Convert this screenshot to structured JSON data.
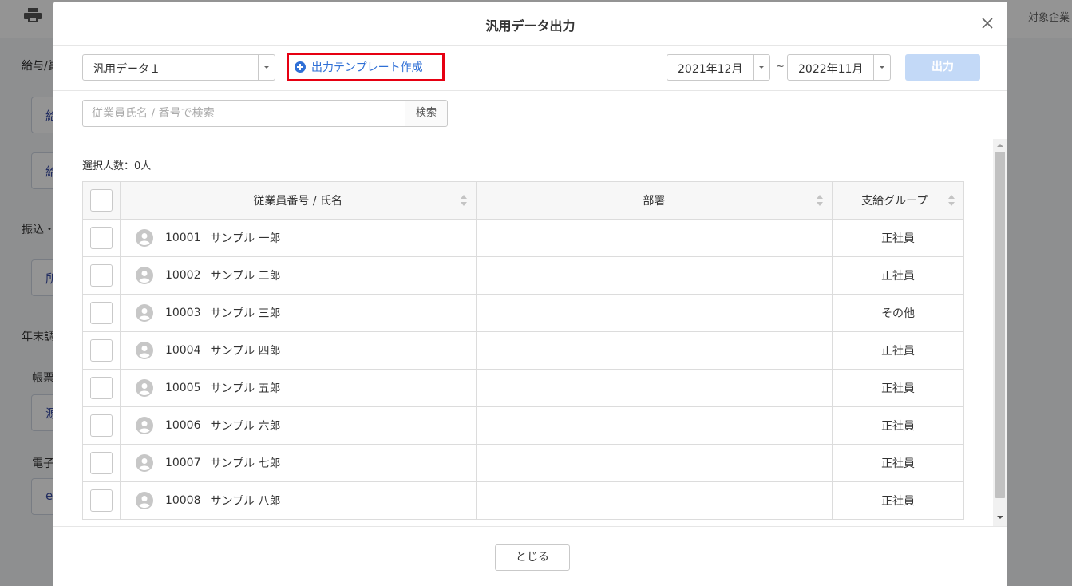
{
  "background": {
    "target_company": "対象企業",
    "sections": [
      "給与/賞",
      "振込・",
      "年末調",
      "帳票",
      "電子"
    ],
    "buttons": [
      "給",
      "給",
      "所",
      "源",
      "e"
    ]
  },
  "modal": {
    "title": "汎用データ出力",
    "close_icon": "close-icon",
    "data_select": "汎用データ１",
    "template_link": "出力テンプレート作成",
    "date_from": "2021年12月",
    "date_to": "2022年11月",
    "tilde": "~",
    "output_label": "出力",
    "search": {
      "placeholder": "従業員氏名 / 番号で検索",
      "button": "検索"
    },
    "selected_count": "選択人数：0人",
    "table": {
      "headers": {
        "employee": "従業員番号 / 氏名",
        "department": "部署",
        "group": "支給グループ"
      },
      "rows": [
        {
          "no": "10001",
          "name": "サンプル 一郎",
          "dept": "",
          "group": "正社員"
        },
        {
          "no": "10002",
          "name": "サンプル 二郎",
          "dept": "",
          "group": "正社員"
        },
        {
          "no": "10003",
          "name": "サンプル 三郎",
          "dept": "",
          "group": "その他"
        },
        {
          "no": "10004",
          "name": "サンプル 四郎",
          "dept": "",
          "group": "正社員"
        },
        {
          "no": "10005",
          "name": "サンプル 五郎",
          "dept": "",
          "group": "正社員"
        },
        {
          "no": "10006",
          "name": "サンプル 六郎",
          "dept": "",
          "group": "正社員"
        },
        {
          "no": "10007",
          "name": "サンプル 七郎",
          "dept": "",
          "group": "正社員"
        },
        {
          "no": "10008",
          "name": "サンプル 八郎",
          "dept": "",
          "group": "正社員"
        }
      ]
    },
    "close_button": "とじる"
  }
}
